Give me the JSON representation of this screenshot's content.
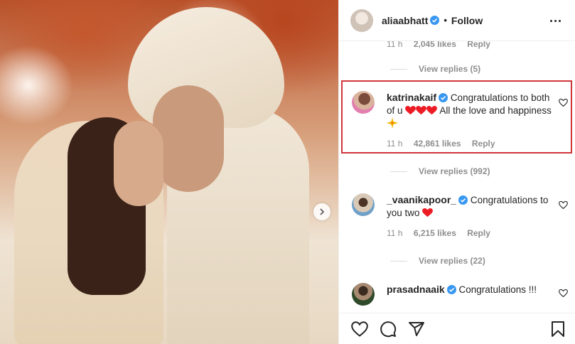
{
  "post": {
    "author": "aliaabhatt",
    "follow_label": "Follow",
    "separator": "•"
  },
  "top_comment_meta": {
    "time": "11 h",
    "likes": "2,045 likes",
    "reply": "Reply"
  },
  "view_replies_1": "View replies (5)",
  "comments": [
    {
      "username": "katrinakaif",
      "text_a": "Congratulations to both of u",
      "text_b": "All the love and happiness",
      "time": "11 h",
      "likes": "42,861 likes",
      "reply": "Reply",
      "view_replies": "View replies (992)"
    },
    {
      "username": "_vaanikapoor_",
      "text_a": "Congratulations to you two",
      "time": "11 h",
      "likes": "6,215 likes",
      "reply": "Reply",
      "view_replies": "View replies (22)"
    },
    {
      "username": "prasadnaaik",
      "text_a": "Congratulations !!!"
    }
  ],
  "colors": {
    "verified": "#3897f0",
    "heart_red": "#ed1c24",
    "highlight_border": "#d0353b",
    "muted_text": "#8e8e8e"
  },
  "icons": [
    "more-options-icon",
    "verified-badge-icon",
    "heart-outline-icon",
    "comment-icon",
    "share-icon",
    "bookmark-icon",
    "carousel-next-icon"
  ]
}
